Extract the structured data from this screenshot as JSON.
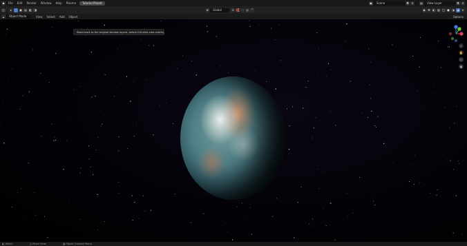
{
  "menus": [
    "File",
    "Edit",
    "Render",
    "Window",
    "Help",
    "Plasma"
  ],
  "active_workspace": "Tutorial Planet",
  "toolbar": {
    "transform_orientation": "Global"
  },
  "scene": {
    "name": "Scene"
  },
  "view_layer": {
    "name": "View Layer"
  },
  "header": {
    "mode": "Object Mode",
    "menu": [
      "View",
      "Select",
      "Add",
      "Object"
    ],
    "options_label": "Options"
  },
  "tooltip": "Reset back to the original window layout, before full-view area overlay",
  "status": {
    "items": [
      "Select",
      "Move View",
      "Object Context Menu"
    ]
  },
  "colors": {
    "selected": "#3f6fbf",
    "gizmo_x": "#e0445a",
    "gizmo_y": "#73c83c",
    "gizmo_z": "#3f7fe0"
  }
}
